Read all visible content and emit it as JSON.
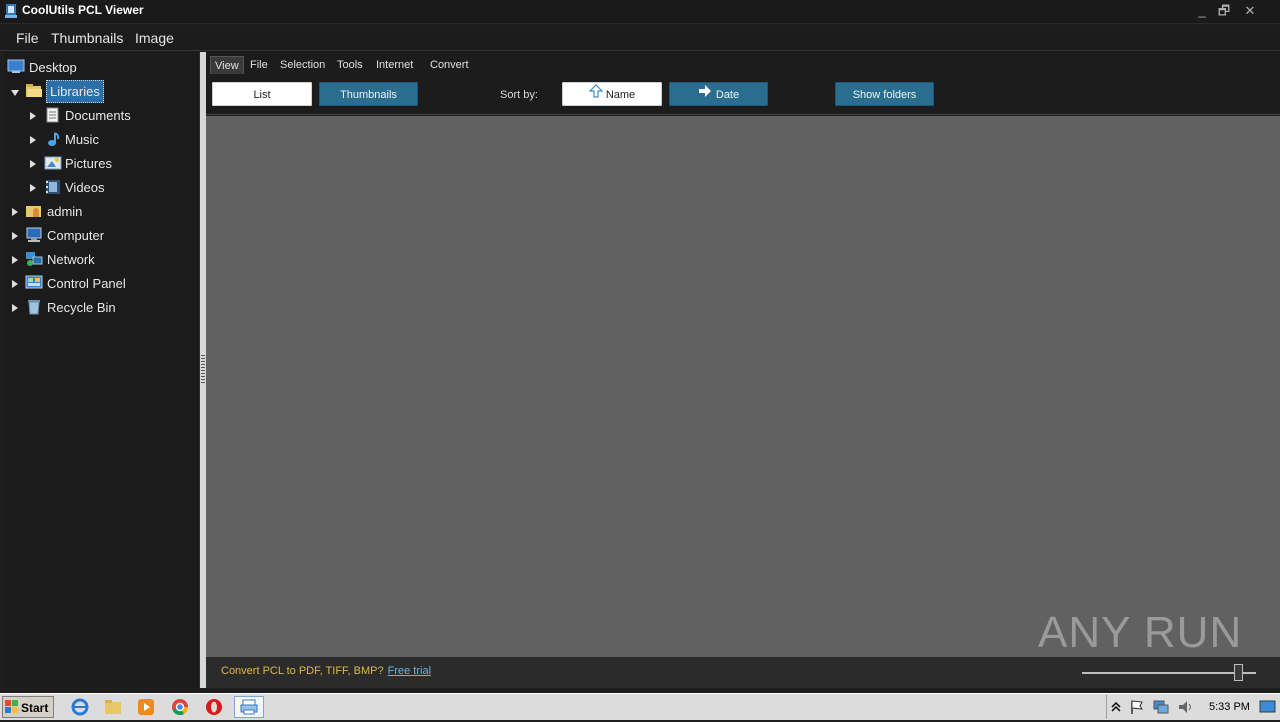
{
  "window": {
    "title": "CoolUtils PCL Viewer",
    "minimize": "_",
    "restore": "🗗",
    "close": "✕"
  },
  "menu": {
    "items": [
      "File",
      "Thumbnails",
      "Image"
    ]
  },
  "sidebar": {
    "root": "Desktop",
    "items": [
      {
        "label": "Libraries",
        "icon": "folder-open-icon",
        "expanded": true,
        "selected": true
      },
      {
        "label": "Documents",
        "icon": "documents-icon"
      },
      {
        "label": "Music",
        "icon": "music-note-icon"
      },
      {
        "label": "Pictures",
        "icon": "pictures-icon"
      },
      {
        "label": "Videos",
        "icon": "videos-icon"
      },
      {
        "label": "admin",
        "icon": "user-folder-icon"
      },
      {
        "label": "Computer",
        "icon": "computer-icon"
      },
      {
        "label": "Network",
        "icon": "network-icon"
      },
      {
        "label": "Control Panel",
        "icon": "control-panel-icon"
      },
      {
        "label": "Recycle Bin",
        "icon": "recycle-bin-icon"
      }
    ]
  },
  "ribbon": {
    "tabs": [
      "View",
      "File",
      "Selection",
      "Tools",
      "Internet",
      "Convert"
    ],
    "active_tab": "View",
    "list_label": "List",
    "thumbnails_label": "Thumbnails",
    "sort_label": "Sort by:",
    "sort_name_label": "Name",
    "sort_date_label": "Date",
    "show_folders_label": "Show folders"
  },
  "status": {
    "promo_text": "Convert PCL to PDF, TIFF, BMP?",
    "promo_link": "Free trial",
    "zoom_level": 0.9
  },
  "watermark": "ANY RUN",
  "taskbar": {
    "start_label": "Start",
    "pinned": [
      "ie-icon",
      "explorer-icon",
      "media-player-icon",
      "chrome-icon",
      "opera-icon",
      "pcl-viewer-icon"
    ],
    "clock": "5:33 PM"
  },
  "colors": {
    "accent_blue": "#2b6d8f",
    "content_bg": "#616161",
    "promo": "#e0b84a",
    "link": "#6fb3e0"
  }
}
